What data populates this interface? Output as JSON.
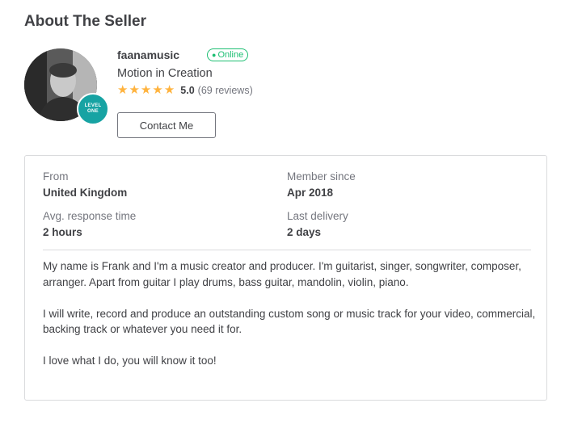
{
  "section": {
    "title": "About The Seller"
  },
  "seller": {
    "username": "faanamusic",
    "status": "Online",
    "tagline": "Motion in Creation",
    "level_badge": [
      "LEVEL",
      "ONE"
    ],
    "rating": {
      "stars": 5,
      "score": "5.0",
      "reviews": "(69 reviews)"
    },
    "contact_label": "Contact Me"
  },
  "stats": {
    "from": {
      "label": "From",
      "value": "United Kingdom"
    },
    "member_since": {
      "label": "Member since",
      "value": "Apr 2018"
    },
    "response_time": {
      "label": "Avg. response time",
      "value": "2 hours"
    },
    "last_delivery": {
      "label": "Last delivery",
      "value": "2 days"
    }
  },
  "description": [
    "My name is Frank and I'm a music creator and producer. I'm guitarist, singer, songwriter, composer, arranger. Apart from guitar I play drums, bass guitar, mandolin, violin, piano.",
    "I will write, record and produce an outstanding custom song or music track for your video, commercial, backing track or whatever you need it for.",
    "I love what I do, you will know it too!"
  ],
  "colors": {
    "online": "#1dbf73",
    "star": "#ffb33e",
    "badge": "#17a3a3",
    "text": "#404145",
    "muted": "#74767e",
    "border": "#dadbdd"
  },
  "icons": {
    "star": "star-icon",
    "online": "online-dot-icon"
  }
}
